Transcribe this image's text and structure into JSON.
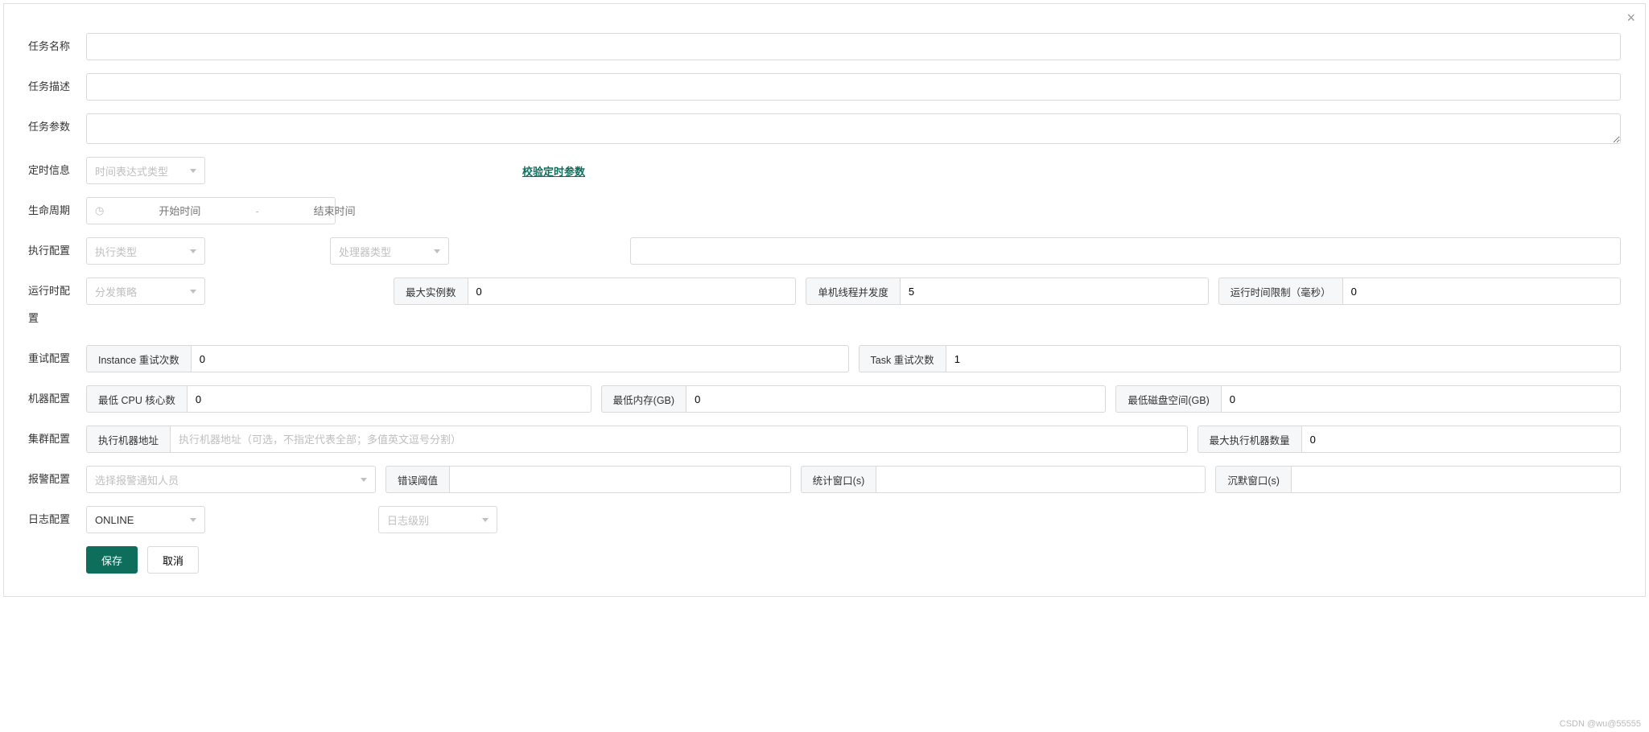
{
  "form": {
    "task_name": {
      "label": "任务名称",
      "value": ""
    },
    "task_desc": {
      "label": "任务描述",
      "value": ""
    },
    "task_params": {
      "label": "任务参数",
      "value": ""
    },
    "schedule": {
      "label": "定时信息",
      "expr_type_placeholder": "时间表达式类型",
      "validate_link": "校验定时参数"
    },
    "lifecycle": {
      "label": "生命周期",
      "start_placeholder": "开始时间",
      "end_placeholder": "结束时间",
      "separator": "-"
    },
    "exec": {
      "label": "执行配置",
      "exec_type_placeholder": "执行类型",
      "processor_type_placeholder": "处理器类型",
      "extra_value": ""
    },
    "runtime": {
      "label": "运行时配置",
      "dispatch_placeholder": "分发策略",
      "max_instance": {
        "addon": "最大实例数",
        "value": "0"
      },
      "thread_parallel": {
        "addon": "单机线程并发度",
        "value": "5"
      },
      "run_limit": {
        "addon": "运行时间限制（毫秒）",
        "value": "0"
      }
    },
    "retry": {
      "label": "重试配置",
      "instance": {
        "addon": "Instance 重试次数",
        "value": "0"
      },
      "task": {
        "addon": "Task 重试次数",
        "value": "1"
      }
    },
    "machine": {
      "label": "机器配置",
      "min_cpu": {
        "addon": "最低 CPU 核心数",
        "value": "0"
      },
      "min_mem": {
        "addon": "最低内存(GB)",
        "value": "0"
      },
      "min_disk": {
        "addon": "最低磁盘空间(GB)",
        "value": "0"
      }
    },
    "cluster": {
      "label": "集群配置",
      "address": {
        "addon": "执行机器地址",
        "placeholder": "执行机器地址（可选，不指定代表全部；多值英文逗号分割）",
        "value": ""
      },
      "max_exec": {
        "addon": "最大执行机器数量",
        "value": "0"
      }
    },
    "alarm": {
      "label": "报警配置",
      "people_placeholder": "选择报警通知人员",
      "threshold": {
        "addon": "错误阈值",
        "value": ""
      },
      "stat_window": {
        "addon": "统计窗口(s)",
        "value": ""
      },
      "silence_window": {
        "addon": "沉默窗口(s)",
        "value": ""
      }
    },
    "log": {
      "label": "日志配置",
      "online_value": "ONLINE",
      "level_placeholder": "日志级别"
    },
    "buttons": {
      "save": "保存",
      "cancel": "取消"
    }
  },
  "watermark": "CSDN @wu@55555"
}
